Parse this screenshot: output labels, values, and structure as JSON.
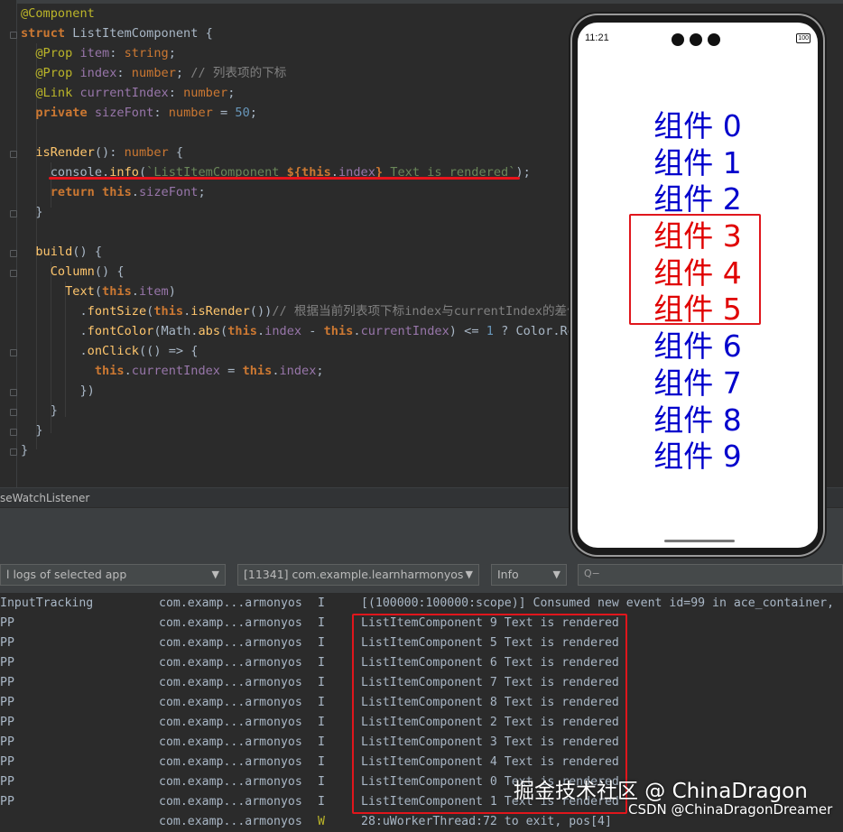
{
  "editor": {
    "lines": [
      [
        {
          "c": "ann",
          "t": "@Component"
        }
      ],
      [
        {
          "c": "kw",
          "t": "struct "
        },
        {
          "c": "",
          "t": "ListItemComponent {"
        }
      ],
      [
        {
          "c": "",
          "t": "  "
        },
        {
          "c": "ann",
          "t": "@Prop "
        },
        {
          "c": "pp",
          "t": "item"
        },
        {
          "c": "",
          "t": ": "
        },
        {
          "c": "ty",
          "t": "string"
        },
        {
          "c": "",
          "t": ";"
        }
      ],
      [
        {
          "c": "",
          "t": "  "
        },
        {
          "c": "ann",
          "t": "@Prop "
        },
        {
          "c": "pp",
          "t": "index"
        },
        {
          "c": "",
          "t": ": "
        },
        {
          "c": "ty",
          "t": "number"
        },
        {
          "c": "",
          "t": "; "
        },
        {
          "c": "cm",
          "t": "// 列表项的下标"
        }
      ],
      [
        {
          "c": "",
          "t": "  "
        },
        {
          "c": "ann",
          "t": "@Link "
        },
        {
          "c": "pp",
          "t": "currentIndex"
        },
        {
          "c": "",
          "t": ": "
        },
        {
          "c": "ty",
          "t": "number"
        },
        {
          "c": "",
          "t": ";"
        }
      ],
      [
        {
          "c": "",
          "t": "  "
        },
        {
          "c": "kw",
          "t": "private "
        },
        {
          "c": "pp",
          "t": "sizeFont"
        },
        {
          "c": "",
          "t": ": "
        },
        {
          "c": "ty",
          "t": "number"
        },
        {
          "c": "",
          "t": " = "
        },
        {
          "c": "num",
          "t": "50"
        },
        {
          "c": "",
          "t": ";"
        }
      ],
      [
        {
          "c": "",
          "t": ""
        }
      ],
      [
        {
          "c": "",
          "t": "  "
        },
        {
          "c": "fn",
          "t": "isRender"
        },
        {
          "c": "",
          "t": "(): "
        },
        {
          "c": "ty",
          "t": "number"
        },
        {
          "c": "",
          "t": " {"
        }
      ],
      [
        {
          "c": "",
          "t": "    console."
        },
        {
          "c": "fn",
          "t": "info"
        },
        {
          "c": "",
          "t": "("
        },
        {
          "c": "str",
          "t": "`ListItemComponent "
        },
        {
          "c": "kw",
          "t": "${"
        },
        {
          "c": "kw",
          "t": "this"
        },
        {
          "c": "",
          "t": "."
        },
        {
          "c": "pp",
          "t": "index"
        },
        {
          "c": "kw",
          "t": "}"
        },
        {
          "c": "str",
          "t": " Text is rendered`"
        },
        {
          "c": "",
          "t": ");"
        }
      ],
      [
        {
          "c": "",
          "t": "    "
        },
        {
          "c": "kw",
          "t": "return "
        },
        {
          "c": "kw",
          "t": "this"
        },
        {
          "c": "",
          "t": "."
        },
        {
          "c": "pp",
          "t": "sizeFont"
        },
        {
          "c": "",
          "t": ";"
        }
      ],
      [
        {
          "c": "",
          "t": "  }"
        }
      ],
      [
        {
          "c": "",
          "t": ""
        }
      ],
      [
        {
          "c": "",
          "t": "  "
        },
        {
          "c": "fn",
          "t": "build"
        },
        {
          "c": "",
          "t": "() {"
        }
      ],
      [
        {
          "c": "",
          "t": "    "
        },
        {
          "c": "fn",
          "t": "Column"
        },
        {
          "c": "",
          "t": "() {"
        }
      ],
      [
        {
          "c": "",
          "t": "      "
        },
        {
          "c": "fn",
          "t": "Text"
        },
        {
          "c": "",
          "t": "("
        },
        {
          "c": "kw",
          "t": "this"
        },
        {
          "c": "",
          "t": "."
        },
        {
          "c": "pp",
          "t": "item"
        },
        {
          "c": "",
          "t": ")"
        }
      ],
      [
        {
          "c": "",
          "t": "        ."
        },
        {
          "c": "fn",
          "t": "fontSize"
        },
        {
          "c": "",
          "t": "("
        },
        {
          "c": "kw",
          "t": "this"
        },
        {
          "c": "",
          "t": "."
        },
        {
          "c": "fn",
          "t": "isRender"
        },
        {
          "c": "",
          "t": "())"
        },
        {
          "c": "cm",
          "t": "// 根据当前列表项下标index与currentIndex的差值来"
        }
      ],
      [
        {
          "c": "",
          "t": "        ."
        },
        {
          "c": "fn",
          "t": "fontColor"
        },
        {
          "c": "",
          "t": "(Math."
        },
        {
          "c": "fn",
          "t": "abs"
        },
        {
          "c": "",
          "t": "("
        },
        {
          "c": "kw",
          "t": "this"
        },
        {
          "c": "",
          "t": "."
        },
        {
          "c": "pp",
          "t": "index"
        },
        {
          "c": "",
          "t": " - "
        },
        {
          "c": "kw",
          "t": "this"
        },
        {
          "c": "",
          "t": "."
        },
        {
          "c": "pp",
          "t": "currentIndex"
        },
        {
          "c": "",
          "t": ") <= "
        },
        {
          "c": "num",
          "t": "1"
        },
        {
          "c": "",
          "t": " ? Color.Red"
        }
      ],
      [
        {
          "c": "",
          "t": "        ."
        },
        {
          "c": "fn",
          "t": "onClick"
        },
        {
          "c": "",
          "t": "(() => {"
        }
      ],
      [
        {
          "c": "",
          "t": "          "
        },
        {
          "c": "kw",
          "t": "this"
        },
        {
          "c": "",
          "t": "."
        },
        {
          "c": "pp",
          "t": "currentIndex"
        },
        {
          "c": "",
          "t": " = "
        },
        {
          "c": "kw",
          "t": "this"
        },
        {
          "c": "",
          "t": "."
        },
        {
          "c": "pp",
          "t": "index"
        },
        {
          "c": "",
          "t": ";"
        }
      ],
      [
        {
          "c": "",
          "t": "        })"
        }
      ],
      [
        {
          "c": "",
          "t": "    }"
        }
      ],
      [
        {
          "c": "",
          "t": "  }"
        }
      ],
      [
        {
          "c": "",
          "t": "}"
        }
      ]
    ]
  },
  "breadcrumb": "seWatchListener",
  "filters": {
    "logs_scope": "l logs of selected app",
    "process": "[11341] com.example.learnharmonyos",
    "level": "Info",
    "search_icon": "Q−"
  },
  "logs": [
    {
      "tag": "InputTracking",
      "pkg": "com.examp...armonyos",
      "lvl": "I",
      "msg": "[(100000:100000:scope)] Consumed new event id=99 in ace_container,"
    },
    {
      "tag": "PP",
      "pkg": "com.examp...armonyos",
      "lvl": "I",
      "msg": "ListItemComponent 9 Text is rendered"
    },
    {
      "tag": "PP",
      "pkg": "com.examp...armonyos",
      "lvl": "I",
      "msg": "ListItemComponent 5 Text is rendered"
    },
    {
      "tag": "PP",
      "pkg": "com.examp...armonyos",
      "lvl": "I",
      "msg": "ListItemComponent 6 Text is rendered"
    },
    {
      "tag": "PP",
      "pkg": "com.examp...armonyos",
      "lvl": "I",
      "msg": "ListItemComponent 7 Text is rendered"
    },
    {
      "tag": "PP",
      "pkg": "com.examp...armonyos",
      "lvl": "I",
      "msg": "ListItemComponent 8 Text is rendered"
    },
    {
      "tag": "PP",
      "pkg": "com.examp...armonyos",
      "lvl": "I",
      "msg": "ListItemComponent 2 Text is rendered"
    },
    {
      "tag": "PP",
      "pkg": "com.examp...armonyos",
      "lvl": "I",
      "msg": "ListItemComponent 3 Text is rendered"
    },
    {
      "tag": "PP",
      "pkg": "com.examp...armonyos",
      "lvl": "I",
      "msg": "ListItemComponent 4 Text is rendered"
    },
    {
      "tag": "PP",
      "pkg": "com.examp...armonyos",
      "lvl": "I",
      "msg": "ListItemComponent 0 Text is rendered"
    },
    {
      "tag": "PP",
      "pkg": "com.examp...armonyos",
      "lvl": "I",
      "msg": "ListItemComponent 1 Text is rendered"
    },
    {
      "tag": "",
      "pkg": "com.examp...armonyos",
      "lvl": "W",
      "msg": "28:uWorkerThread:72 to exit, pos[4]"
    }
  ],
  "phone": {
    "time": "11:21",
    "battery": "100",
    "items": [
      {
        "label": "组件 0",
        "color": "#0000cc"
      },
      {
        "label": "组件 1",
        "color": "#0000cc"
      },
      {
        "label": "组件 2",
        "color": "#0000cc"
      },
      {
        "label": "组件 3",
        "color": "#e00000"
      },
      {
        "label": "组件 4",
        "color": "#e00000"
      },
      {
        "label": "组件 5",
        "color": "#e00000"
      },
      {
        "label": "组件 6",
        "color": "#0000cc"
      },
      {
        "label": "组件 7",
        "color": "#0000cc"
      },
      {
        "label": "组件 8",
        "color": "#0000cc"
      },
      {
        "label": "组件 9",
        "color": "#0000cc"
      }
    ]
  },
  "watermark": {
    "main": "掘金技术社区 @ ChinaDragon",
    "sub": "CSDN @ChinaDragonDreamer"
  },
  "colors": {
    "highlight_box": "#e0161c",
    "editor_bg": "#2b2b2b"
  }
}
